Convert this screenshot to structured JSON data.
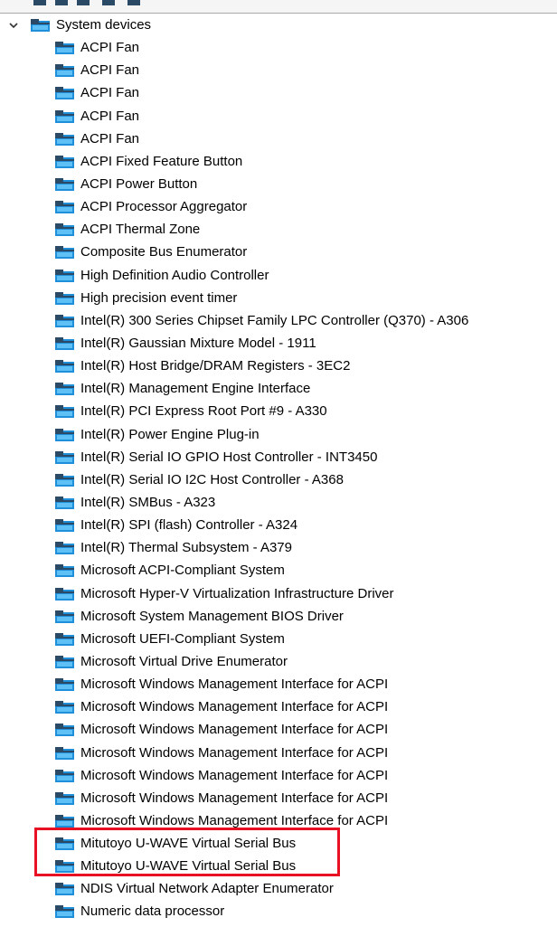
{
  "tree": {
    "root": {
      "label": "System devices",
      "icon": "system-devices-folder-icon",
      "expanded": true
    },
    "items": [
      "ACPI Fan",
      "ACPI Fan",
      "ACPI Fan",
      "ACPI Fan",
      "ACPI Fan",
      "ACPI Fixed Feature Button",
      "ACPI Power Button",
      "ACPI Processor Aggregator",
      "ACPI Thermal Zone",
      "Composite Bus Enumerator",
      "High Definition Audio Controller",
      "High precision event timer",
      "Intel(R) 300 Series Chipset Family LPC Controller (Q370) - A306",
      "Intel(R) Gaussian Mixture Model - 1911",
      "Intel(R) Host Bridge/DRAM Registers - 3EC2",
      "Intel(R) Management Engine Interface",
      "Intel(R) PCI Express Root Port #9 - A330",
      "Intel(R) Power Engine Plug-in",
      "Intel(R) Serial IO GPIO Host Controller - INT3450",
      "Intel(R) Serial IO I2C Host Controller - A368",
      "Intel(R) SMBus - A323",
      "Intel(R) SPI (flash) Controller - A324",
      "Intel(R) Thermal Subsystem - A379",
      "Microsoft ACPI-Compliant System",
      "Microsoft Hyper-V Virtualization Infrastructure Driver",
      "Microsoft System Management BIOS Driver",
      "Microsoft UEFI-Compliant System",
      "Microsoft Virtual Drive Enumerator",
      "Microsoft Windows Management Interface for ACPI",
      "Microsoft Windows Management Interface for ACPI",
      "Microsoft Windows Management Interface for ACPI",
      "Microsoft Windows Management Interface for ACPI",
      "Microsoft Windows Management Interface for ACPI",
      "Microsoft Windows Management Interface for ACPI",
      "Microsoft Windows Management Interface for ACPI",
      "Mitutoyo U-WAVE Virtual Serial Bus",
      "Mitutoyo U-WAVE Virtual Serial Bus",
      "NDIS Virtual Network Adapter Enumerator",
      "Numeric data processor"
    ],
    "item_icon": "system-device-icon",
    "highlighted_items": [
      "Mitutoyo U-WAVE Virtual Serial Bus",
      "Mitutoyo U-WAVE Virtual Serial Bus"
    ]
  },
  "colors": {
    "highlight_border": "#e81123",
    "icon_blue": "#1e8fd8",
    "icon_dark": "#2b4a66"
  }
}
